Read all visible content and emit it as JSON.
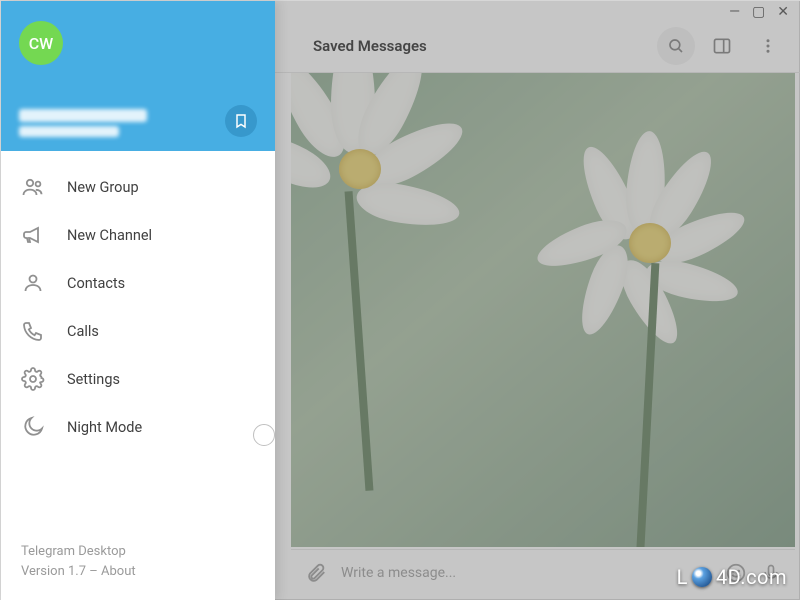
{
  "window": {
    "minimize": "—",
    "maximize": "▢",
    "close": "✕"
  },
  "profile": {
    "avatar_initials": "CW"
  },
  "menu": {
    "new_group": "New Group",
    "new_channel": "New Channel",
    "contacts": "Contacts",
    "calls": "Calls",
    "settings": "Settings",
    "night_mode": "Night Mode",
    "night_mode_on": false
  },
  "footer": {
    "app_name": "Telegram Desktop",
    "version_prefix": "Version 1.7 – ",
    "about": "About"
  },
  "chat": {
    "title": "Saved Messages",
    "input_placeholder": "Write a message..."
  },
  "watermark": {
    "prefix": "L",
    "suffix": "4D.com"
  },
  "colors": {
    "accent": "#47aee3",
    "avatar": "#74d852",
    "icon": "#909090"
  }
}
